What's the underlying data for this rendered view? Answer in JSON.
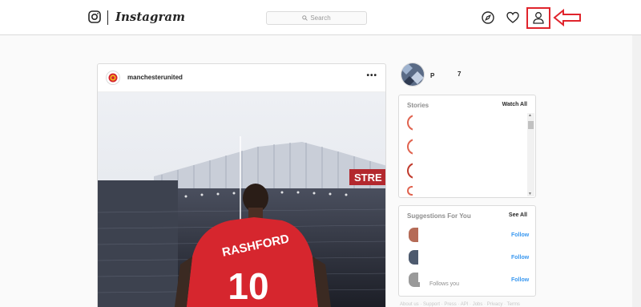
{
  "nav": {
    "brand": "Instagram",
    "search_placeholder": "Search",
    "icons": [
      "instagram-glyph-icon",
      "compass-icon",
      "heart-icon",
      "profile-icon",
      "red-arrow-annotation"
    ]
  },
  "post": {
    "username": "manchesterunited",
    "more": "•••",
    "jersey_name": "RASHFORD",
    "jersey_number": "10",
    "stadium_sign": "STRE"
  },
  "profile": {
    "name_left": "P",
    "name_right": "7"
  },
  "stories": {
    "title": "Stories",
    "link": "Watch All",
    "scroll_up": "▲",
    "scroll_down": "▼"
  },
  "suggestions": {
    "title": "Suggestions For You",
    "link": "See All",
    "follows_you": "Follows you",
    "follow_labels": [
      "Follow",
      "Follow",
      "Follow"
    ]
  },
  "footer": {
    "links": "About us · Support · Press · API · Jobs · Privacy · Terms"
  },
  "colors": {
    "highlight": "#e0242c",
    "link_blue": "#3897f0",
    "jersey_red": "#d6262e"
  }
}
